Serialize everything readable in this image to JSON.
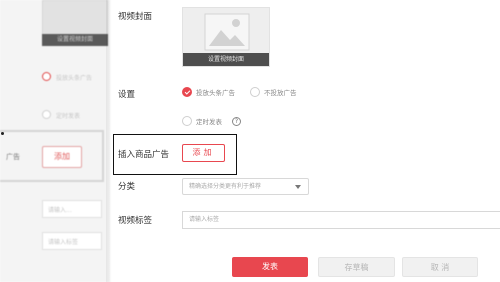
{
  "background": {
    "cover_button": "设置视频封面",
    "radio_1": "投放头条广告",
    "radio_2": "定时发表",
    "label": "广告",
    "add_button": "添加",
    "field_1": "请输入...",
    "field_2": "请输入标签"
  },
  "form": {
    "cover": {
      "label": "视频封面",
      "button": "设置视频封面"
    },
    "settings": {
      "label": "设置",
      "options": [
        "投放头条广告",
        "不投放广告"
      ],
      "selected": "投放头条广告",
      "schedule_label": "定时发表",
      "help_icon": "question-circle-icon"
    },
    "product_ad": {
      "label": "插入商品广告",
      "button": "添加"
    },
    "category": {
      "label": "分类",
      "placeholder": "精确选择分类更有利于推荐",
      "icon": "caret-down-icon"
    },
    "tags": {
      "label": "视频标签",
      "placeholder": "请输入标签"
    }
  },
  "actions": {
    "publish": "发表",
    "save_draft": "存草稿",
    "cancel": "取 消"
  },
  "colors": {
    "accent": "#e8474f",
    "highlight_border": "#111111"
  }
}
